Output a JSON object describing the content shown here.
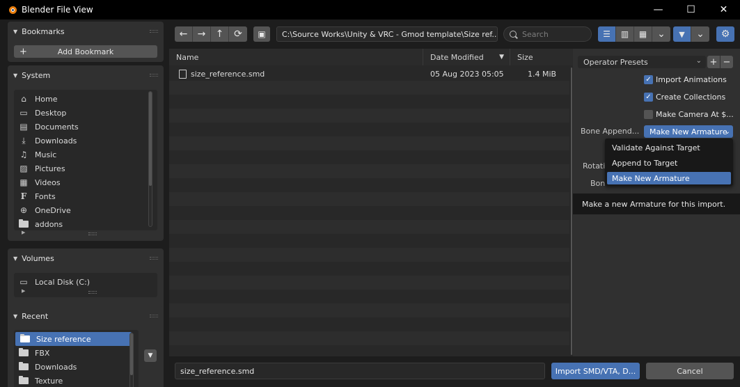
{
  "window": {
    "title": "Blender File View",
    "minimize_glyph": "—",
    "maximize_glyph": "☐",
    "close_glyph": "✕"
  },
  "sidebar": {
    "bookmarks": {
      "title": "Bookmarks",
      "add_label": "Add Bookmark"
    },
    "system": {
      "title": "System",
      "items": [
        {
          "label": "Home",
          "icon": "home-icon"
        },
        {
          "label": "Desktop",
          "icon": "desktop-icon"
        },
        {
          "label": "Documents",
          "icon": "documents-icon"
        },
        {
          "label": "Downloads",
          "icon": "downloads-icon"
        },
        {
          "label": "Music",
          "icon": "music-icon"
        },
        {
          "label": "Pictures",
          "icon": "pictures-icon"
        },
        {
          "label": "Videos",
          "icon": "videos-icon"
        },
        {
          "label": "Fonts",
          "icon": "fonts-icon"
        },
        {
          "label": "OneDrive",
          "icon": "globe-icon"
        },
        {
          "label": "addons",
          "icon": "folder-icon"
        }
      ]
    },
    "volumes": {
      "title": "Volumes",
      "items": [
        {
          "label": "Local Disk (C:)",
          "icon": "disk-icon"
        }
      ]
    },
    "recent": {
      "title": "Recent",
      "items": [
        {
          "label": "Size reference",
          "selected": true
        },
        {
          "label": "FBX"
        },
        {
          "label": "Downloads"
        },
        {
          "label": "Texture"
        }
      ]
    }
  },
  "toolbar": {
    "back_glyph": "←",
    "forward_glyph": "→",
    "parent_glyph": "↑",
    "refresh_glyph": "⟳",
    "new_folder_glyph": "▣",
    "path": "C:\\Source Works\\Unity & VRC - Gmod template\\Size ref...",
    "search_placeholder": "Search",
    "filter_glyph": "▼",
    "settings_glyph": "⚙",
    "dropdown_glyph": "⌄"
  },
  "file_list": {
    "columns": {
      "name": "Name",
      "date": "Date Modified",
      "size": "Size"
    },
    "sort_glyph": "▼",
    "rows": [
      {
        "name": "size_reference.smd",
        "date": "05 Aug 2023 05:05",
        "size": "1.4 MiB"
      }
    ]
  },
  "operator": {
    "presets_label": "Operator Presets",
    "add_glyph": "+",
    "remove_glyph": "−",
    "import_animations": "Import Animations",
    "create_collections": "Create Collections",
    "make_camera": "Make Camera At $...",
    "bone_append_label": "Bone Append...",
    "bone_append_value": "Make New Armature",
    "rotation_label": "Rotati",
    "bone_label": "Bon"
  },
  "dropdown": {
    "items": [
      {
        "label": "Validate Against Target"
      },
      {
        "label": "Append to Target"
      },
      {
        "label": "Make New Armature",
        "selected": true
      }
    ],
    "tooltip": "Make a new Armature for this import."
  },
  "bottom": {
    "filename": "size_reference.smd",
    "import_label": "Import SMD/VTA, D...",
    "cancel_label": "Cancel"
  },
  "colors": {
    "accent": "#4772b3",
    "panel": "#303030",
    "background": "#1d1d1d",
    "button": "#545454"
  }
}
